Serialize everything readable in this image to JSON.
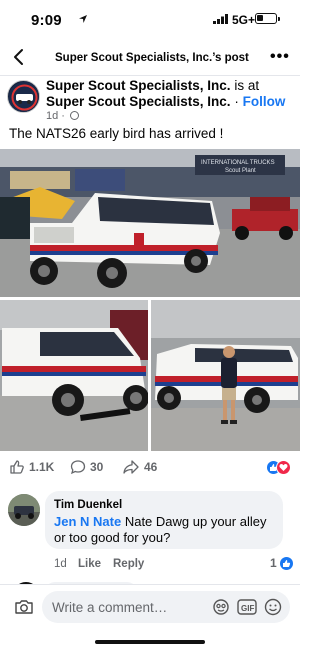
{
  "status_bar": {
    "time": "9:09",
    "network": "5G+"
  },
  "header": {
    "title": "Super Scout Specialists, Inc.’s post"
  },
  "post": {
    "author": "Super Scout Specialists, Inc.",
    "is_at": "is at",
    "location": "Super Scout Specialists, Inc.",
    "dot": "·",
    "follow_label": "Follow",
    "time": "1d ·",
    "text": "The NATS26 early bird has arrived !"
  },
  "photos": {
    "main_sign": "INTERNATIONAL TRUCKS",
    "main_sign2": "Scout Plant"
  },
  "reactions": {
    "likes": "1.1K",
    "comments": "30",
    "shares": "46",
    "colors": {
      "like": "#1877f2",
      "love": "#f0284a"
    }
  },
  "comment": {
    "author": "Tim Duenkel",
    "tag": "Jen N Nate",
    "text": "Nate Dawg up your alley or too good for you?",
    "time": "1d",
    "like_label": "Like",
    "reply_label": "Reply",
    "like_count": "1"
  },
  "composer": {
    "placeholder": "Write a comment…"
  },
  "icons": [
    "back-arrow-icon",
    "more-icon",
    "globe-icon",
    "like-icon",
    "comment-icon",
    "share-icon",
    "camera-icon",
    "avatar-sticker-icon",
    "gif-icon",
    "emoji-icon"
  ]
}
